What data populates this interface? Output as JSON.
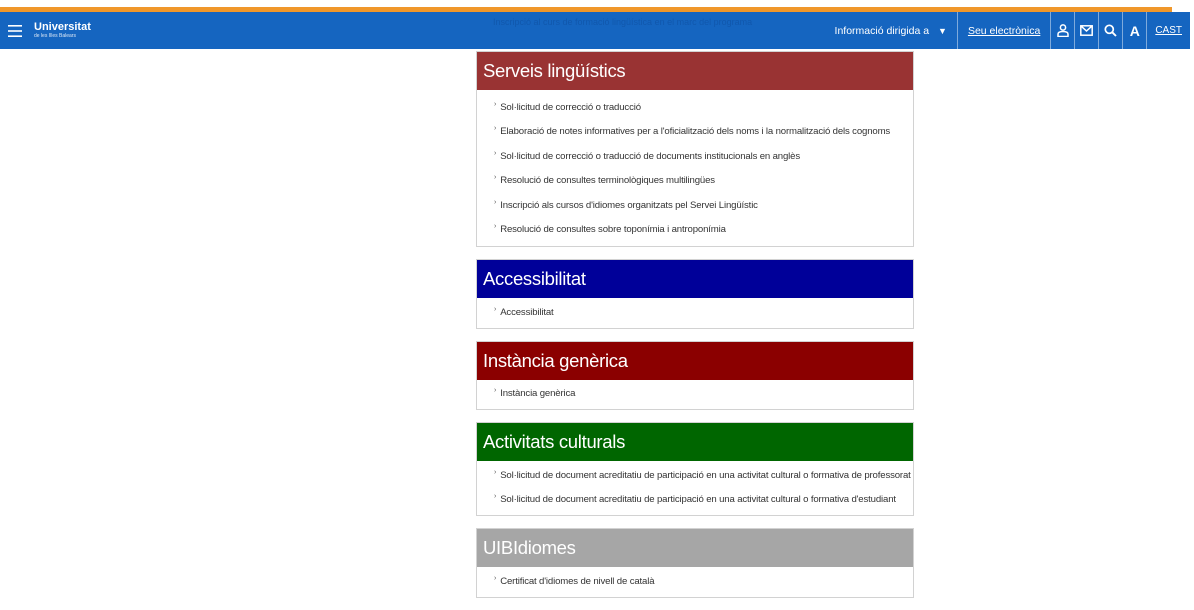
{
  "header": {
    "logo_main": "Universitat",
    "logo_sub": "de les Illes Balears",
    "info_dropdown": "Informació dirigida a",
    "seu_link": "Seu electrònica",
    "lang_link": "CAST",
    "ghost_text": "Inscripció al curs de formació lingüística en el marc del programa"
  },
  "colors": {
    "topbar": "#1565c0",
    "orange": "#f0972a",
    "serveis": "#993333",
    "accessibilitat": "#000099",
    "instancia": "#8b0000",
    "activitats": "#006600",
    "uibidiomes": "#a6a6a6"
  },
  "icons": [
    "menu-icon",
    "user-icon",
    "mail-icon",
    "search-icon",
    "font-size-icon",
    "chevron-down-icon"
  ],
  "sections": [
    {
      "title": "Serveis lingüístics",
      "items": [
        "Sol·licitud de correcció o traducció",
        "Elaboració de notes informatives per a l'oficialització dels noms i la normalització dels cognoms",
        "Sol·licitud de correcció o traducció de documents institucionals en anglès",
        "Resolució de consultes terminològiques multilingües",
        "Inscripció als cursos d'idiomes organitzats pel Servei Lingüístic",
        "Resolució de consultes sobre toponímia i antroponímia"
      ]
    },
    {
      "title": "Accessibilitat",
      "items": [
        "Accessibilitat"
      ]
    },
    {
      "title": "Instància genèrica",
      "items": [
        "Instància genèrica"
      ]
    },
    {
      "title": "Activitats culturals",
      "items": [
        "Sol·licitud de document acreditatiu de participació en una activitat cultural o formativa de professorat",
        "Sol·licitud de document acreditatiu de participació en una activitat cultural o formativa d'estudiant"
      ]
    },
    {
      "title": "UIBIdiomes",
      "items": [
        "Certificat d'idiomes de nivell de català"
      ]
    }
  ]
}
